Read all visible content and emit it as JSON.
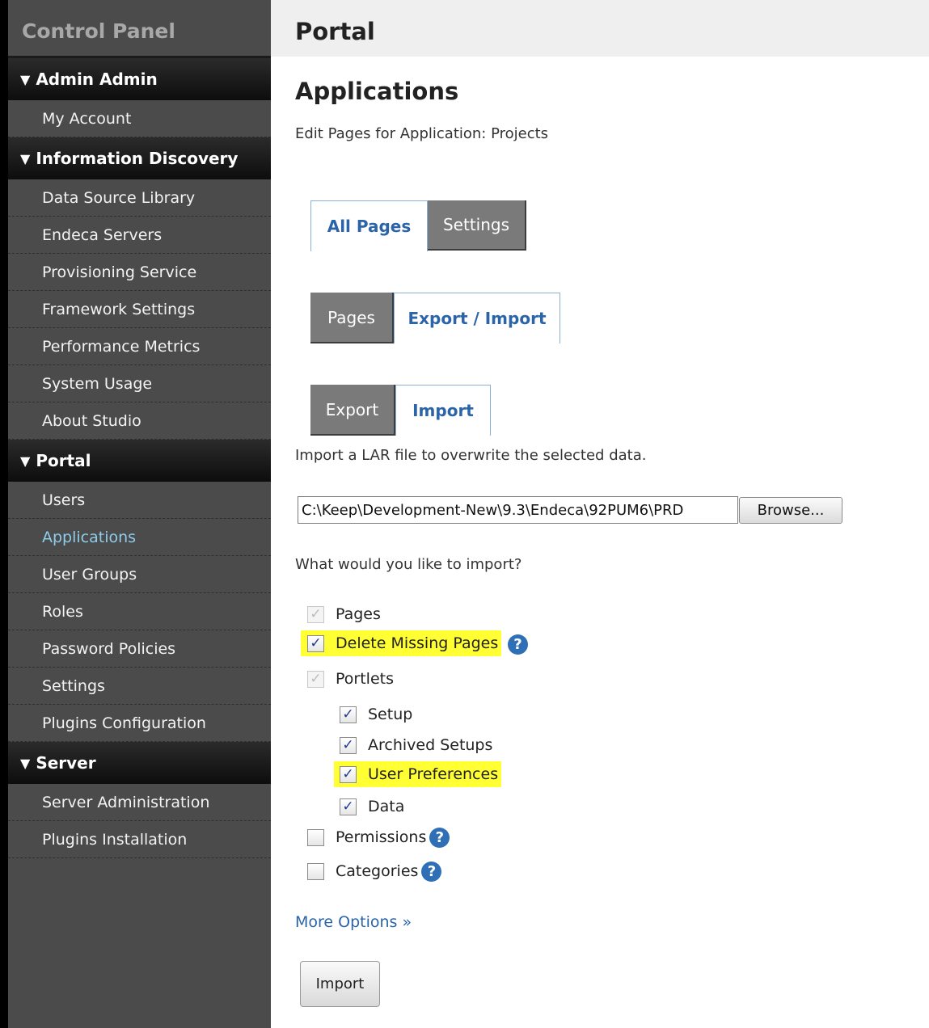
{
  "sidebar": {
    "title": "Control Panel",
    "sections": [
      {
        "header": "Admin Admin",
        "items": [
          "My Account"
        ]
      },
      {
        "header": "Information Discovery",
        "items": [
          "Data Source Library",
          "Endeca Servers",
          "Provisioning Service",
          "Framework Settings",
          "Performance Metrics",
          "System Usage",
          "About Studio"
        ]
      },
      {
        "header": "Portal",
        "items": [
          "Users",
          "Applications",
          "User Groups",
          "Roles",
          "Password Policies",
          "Settings",
          "Plugins Configuration"
        ]
      },
      {
        "header": "Server",
        "items": [
          "Server Administration",
          "Plugins Installation"
        ]
      }
    ],
    "active_item": "Applications"
  },
  "header": {
    "title": "Portal"
  },
  "page": {
    "heading": "Applications",
    "description": "Edit Pages for Application: Projects"
  },
  "tabs": {
    "level1": {
      "all_pages": "All Pages",
      "settings": "Settings"
    },
    "level2": {
      "pages": "Pages",
      "export_import": "Export / Import"
    },
    "level3": {
      "export": "Export",
      "import": "Import"
    }
  },
  "import_form": {
    "description": "Import a LAR file to overwrite the selected data.",
    "file_value": "C:\\Keep\\Development-New\\9.3\\Endeca\\92PUM6\\PRD",
    "browse_label": "Browse...",
    "question": "What would you like to import?",
    "options": {
      "pages": "Pages",
      "delete_missing_pages": "Delete Missing Pages",
      "portlets": "Portlets",
      "setup": "Setup",
      "archived_setups": "Archived Setups",
      "user_preferences": "User Preferences",
      "data": "Data",
      "permissions": "Permissions",
      "categories": "Categories"
    },
    "more_options": "More Options »",
    "import_button": "Import"
  },
  "colors": {
    "sidebar_bg": "#4b4b4b",
    "active_link": "#8ecdea",
    "tab_selected_text": "#2b64a8",
    "highlight": "#ffff33"
  }
}
